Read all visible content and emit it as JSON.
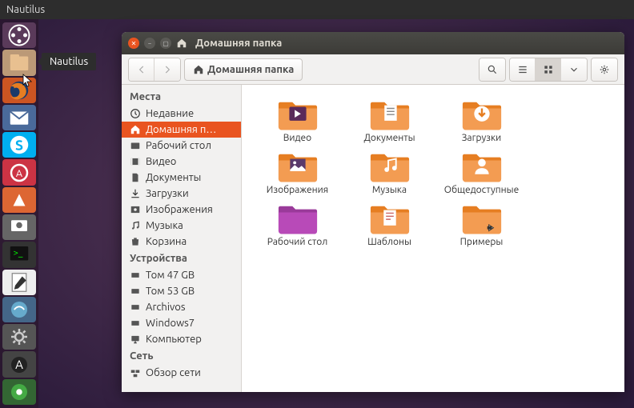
{
  "topbar": {
    "app_name": "Nautilus"
  },
  "launcher": {
    "tooltip": "Nautilus"
  },
  "window": {
    "title": "Домашняя папка",
    "breadcrumb": "Домашняя папка"
  },
  "sidebar": {
    "places": {
      "header": "Места",
      "items": [
        {
          "name": "recent",
          "label": "Недавние"
        },
        {
          "name": "home",
          "label": "Домашняя п…"
        },
        {
          "name": "desktop",
          "label": "Рабочий стол"
        },
        {
          "name": "videos",
          "label": "Видео"
        },
        {
          "name": "documents",
          "label": "Документы"
        },
        {
          "name": "downloads",
          "label": "Загрузки"
        },
        {
          "name": "pictures",
          "label": "Изображения"
        },
        {
          "name": "music",
          "label": "Музыка"
        },
        {
          "name": "trash",
          "label": "Корзина"
        }
      ]
    },
    "devices": {
      "header": "Устройства",
      "items": [
        {
          "name": "vol47",
          "label": "Том 47 GB"
        },
        {
          "name": "vol53",
          "label": "Том 53 GB"
        },
        {
          "name": "archivos",
          "label": "Archivos"
        },
        {
          "name": "windows7",
          "label": "Windows7"
        },
        {
          "name": "computer",
          "label": "Компьютер"
        }
      ]
    },
    "network": {
      "header": "Сеть",
      "items": [
        {
          "name": "browse-network",
          "label": "Обзор сети"
        }
      ]
    }
  },
  "folders": [
    {
      "name": "videos",
      "label": "Видео",
      "badge": "video"
    },
    {
      "name": "documents",
      "label": "Документы",
      "badge": "doc"
    },
    {
      "name": "downloads",
      "label": "Загрузки",
      "badge": "download"
    },
    {
      "name": "pictures",
      "label": "Изображения",
      "badge": "picture"
    },
    {
      "name": "music",
      "label": "Музыка",
      "badge": "music"
    },
    {
      "name": "public",
      "label": "Общедоступные",
      "badge": "public"
    },
    {
      "name": "desktop",
      "label": "Рабочий стол",
      "badge": "desktop",
      "color": "purple"
    },
    {
      "name": "templates",
      "label": "Шаблоны",
      "badge": "template"
    },
    {
      "name": "examples",
      "label": "Примеры",
      "badge": "link"
    }
  ]
}
